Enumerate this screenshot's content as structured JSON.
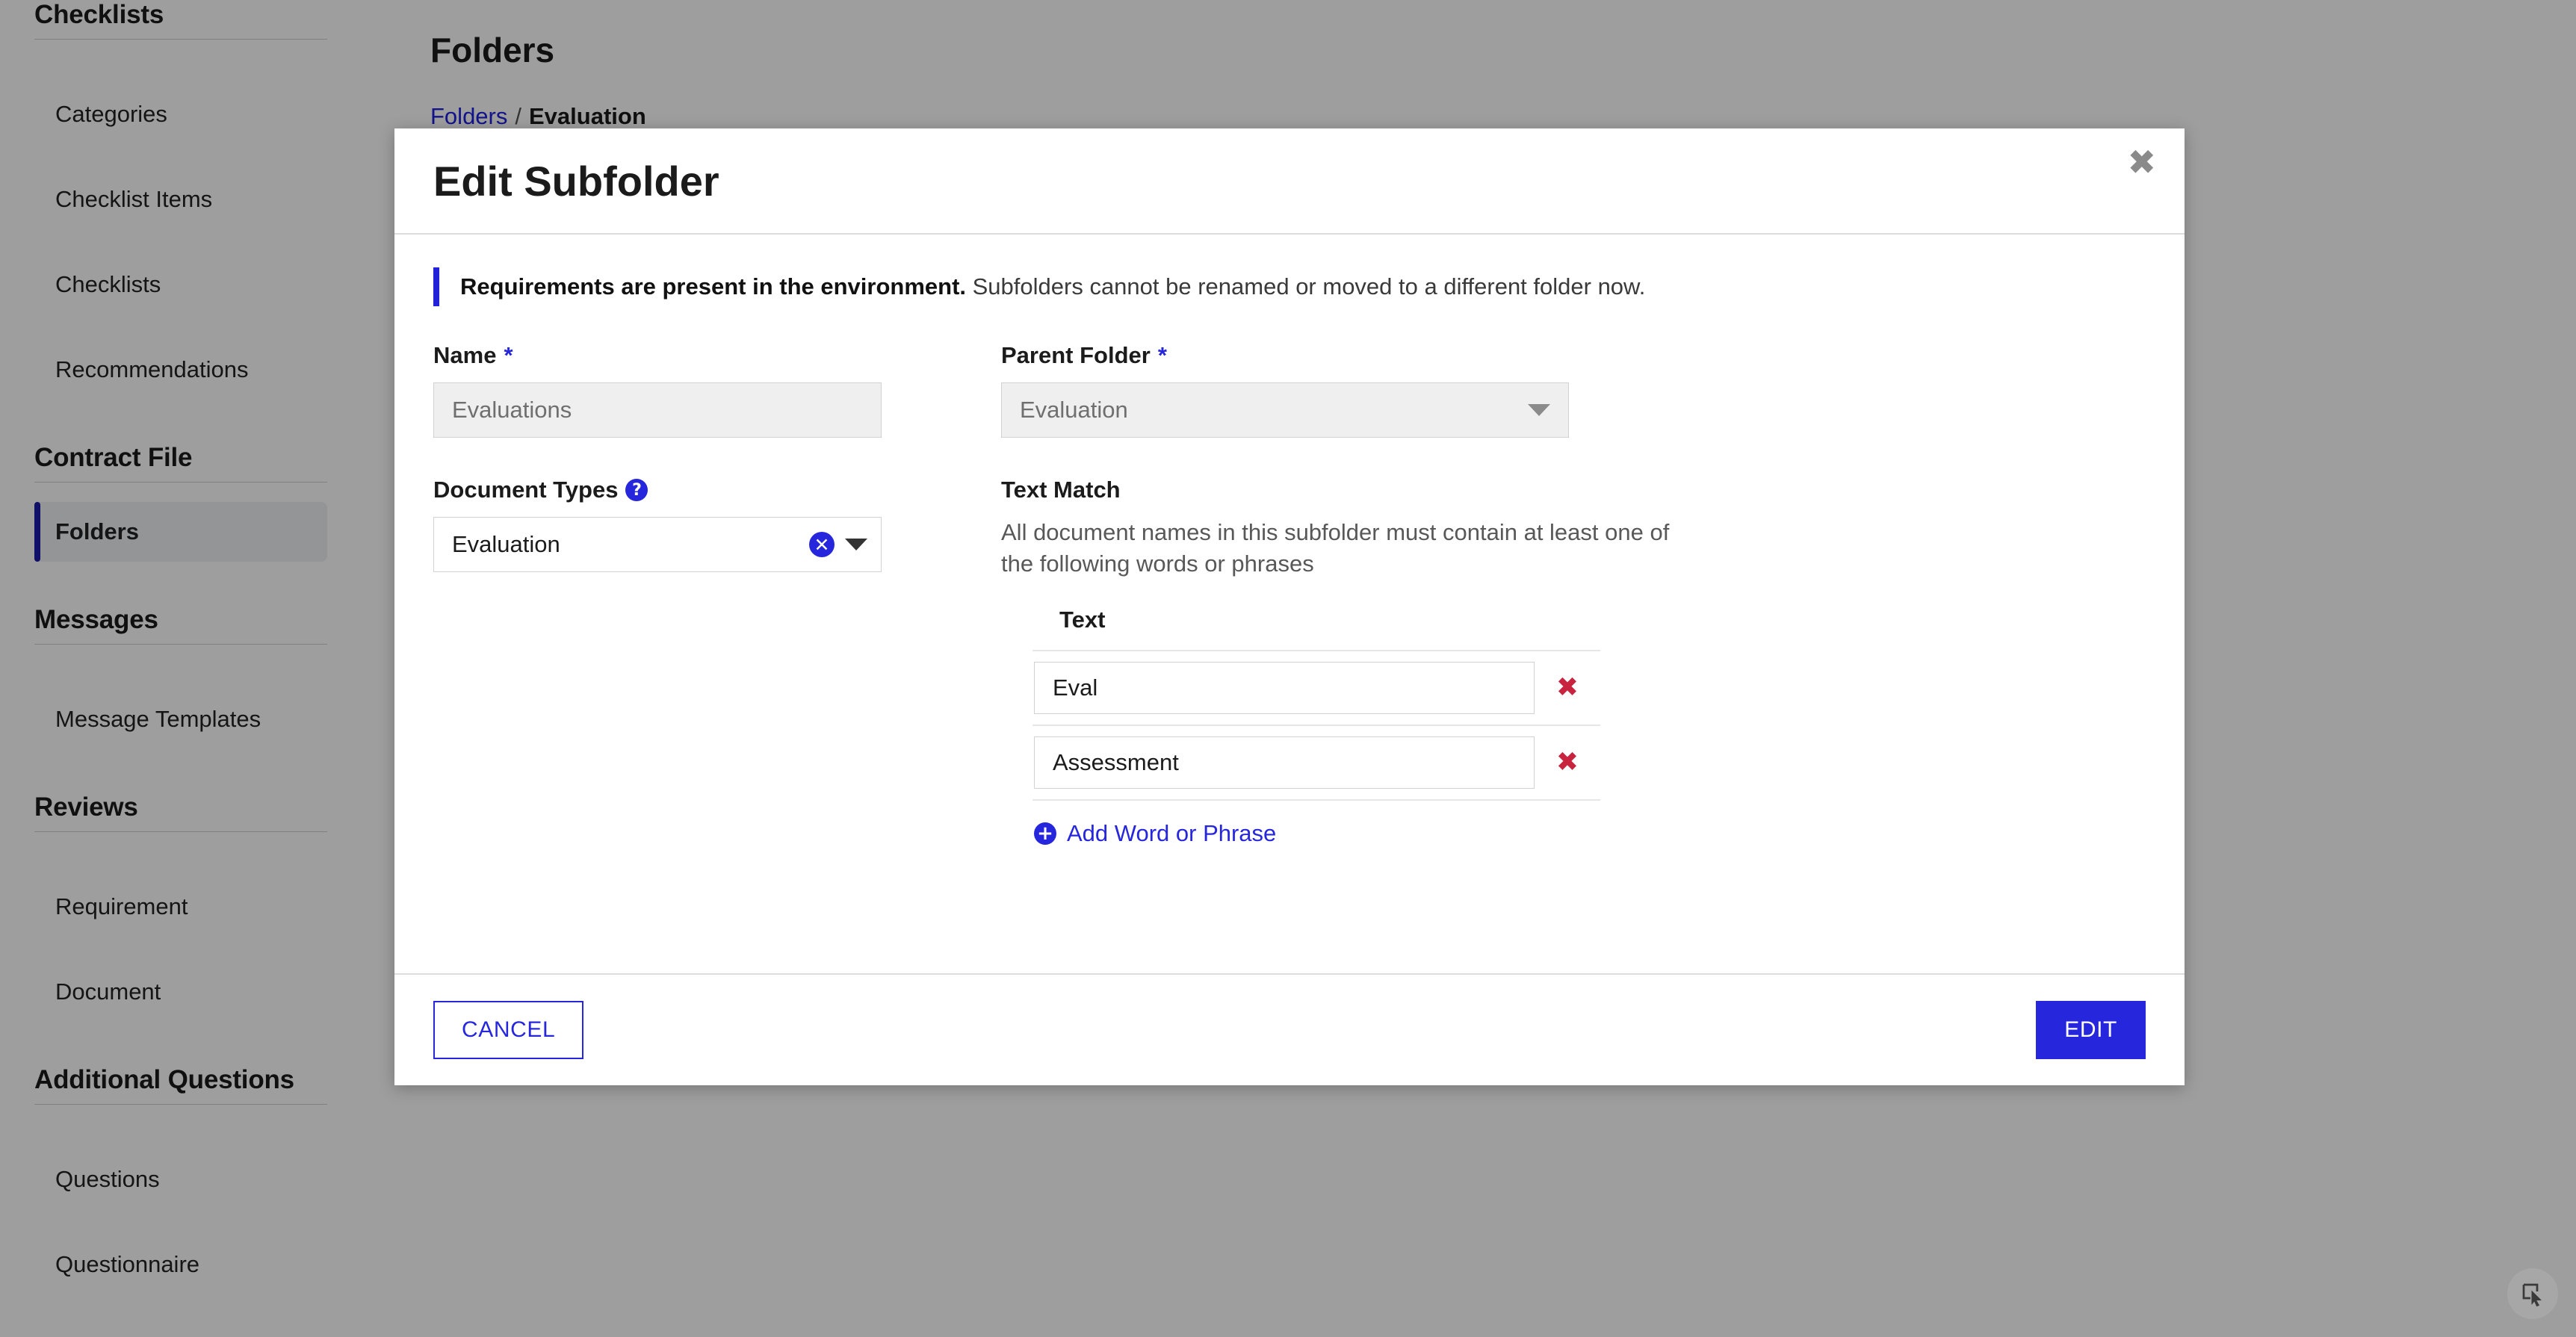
{
  "sidebar": {
    "groups": [
      {
        "title": "Checklists",
        "items": [
          {
            "label": "Categories",
            "active": false
          },
          {
            "label": "Checklist Items",
            "active": false
          },
          {
            "label": "Checklists",
            "active": false
          },
          {
            "label": "Recommendations",
            "active": false
          }
        ]
      },
      {
        "title": "Contract File",
        "items": [
          {
            "label": "Folders",
            "active": true
          }
        ]
      },
      {
        "title": "Messages",
        "items": [
          {
            "label": "Message Templates",
            "active": false
          }
        ]
      },
      {
        "title": "Reviews",
        "items": [
          {
            "label": "Requirement",
            "active": false
          },
          {
            "label": "Document",
            "active": false
          }
        ]
      },
      {
        "title": "Additional Questions",
        "items": [
          {
            "label": "Questions",
            "active": false
          },
          {
            "label": "Questionnaire",
            "active": false
          }
        ]
      }
    ]
  },
  "page": {
    "title": "Folders",
    "breadcrumb": {
      "root": "Folders",
      "separator": "/",
      "current": "Evaluation"
    }
  },
  "modal": {
    "title": "Edit Subfolder",
    "close_icon": "close-icon",
    "alert": {
      "strong": "Requirements are present in the environment.",
      "text": " Subfolders cannot be renamed or moved to a different folder now."
    },
    "fields": {
      "name": {
        "label": "Name",
        "required_mark": "*",
        "value": "Evaluations",
        "disabled": true
      },
      "parent_folder": {
        "label": "Parent Folder",
        "required_mark": "*",
        "value": "Evaluation",
        "disabled": true,
        "caret_icon": "chevron-down-icon"
      },
      "document_types": {
        "label": "Document Types",
        "help_icon": "help-icon",
        "help_glyph": "?",
        "value": "Evaluation",
        "clear_glyph": "✕",
        "caret_icon": "chevron-down-icon"
      }
    },
    "text_match": {
      "title": "Text Match",
      "description": "All document names in this subfolder must contain at least one of the following words or phrases",
      "column_header": "Text",
      "rows": [
        {
          "value": "Eval",
          "delete_glyph": "✖"
        },
        {
          "value": "Assessment",
          "delete_glyph": "✖"
        }
      ],
      "add_label": "Add Word or Phrase",
      "add_glyph": "✚"
    },
    "footer": {
      "cancel_label": "CANCEL",
      "submit_label": "EDIT"
    }
  },
  "colors": {
    "accent": "#2626dd",
    "sidebar_active_bar": "#1a1aa8",
    "danger": "#c9243f",
    "overlay": "#9b9b9b"
  }
}
